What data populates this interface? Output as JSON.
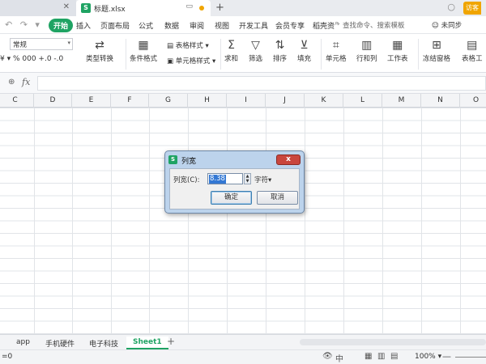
{
  "tabbar": {
    "file_name": "标题.xlsx",
    "file_icon": "S",
    "new_tab": "+",
    "login": "访客"
  },
  "ribbon_tabs": {
    "items": [
      "开始",
      "插入",
      "页面布局",
      "公式",
      "数据",
      "审阅",
      "视图",
      "开发工具",
      "会员专享",
      "稻壳资"
    ],
    "more": "›",
    "search": "查找命令、搜索模板",
    "sync": "未同步"
  },
  "ribbon": {
    "number_format": "常规",
    "num_row": "¥ ▾  %  000  +.0  -.0",
    "type_convert": "类型转换",
    "cond_format": "条件格式",
    "table_style": "表格样式",
    "cell_style": "单元格样式",
    "sum": "求和",
    "filter": "筛选",
    "sort": "排序",
    "fill": "填充",
    "cell": "单元格",
    "row_col": "行和列",
    "worksheet": "工作表",
    "freeze": "冻结窗格",
    "table_tools": "表格工"
  },
  "formula_bar": {
    "fx": "fx"
  },
  "columns": [
    "C",
    "D",
    "E",
    "F",
    "G",
    "H",
    "I",
    "J",
    "K",
    "L",
    "M",
    "N",
    "O"
  ],
  "dialog": {
    "title": "列宽",
    "close": "x",
    "label": "列宽(C):",
    "value": "8.38",
    "unit": "字符▾",
    "ok": "确定",
    "cancel": "取消"
  },
  "sheets": {
    "items": [
      "app",
      "手机硬件",
      "电子科技"
    ],
    "active": "Sheet1",
    "add": "+"
  },
  "statusbar": {
    "left": "=0",
    "zoom": "100%",
    "zoom_arrow": "▾",
    "minus": "—"
  }
}
